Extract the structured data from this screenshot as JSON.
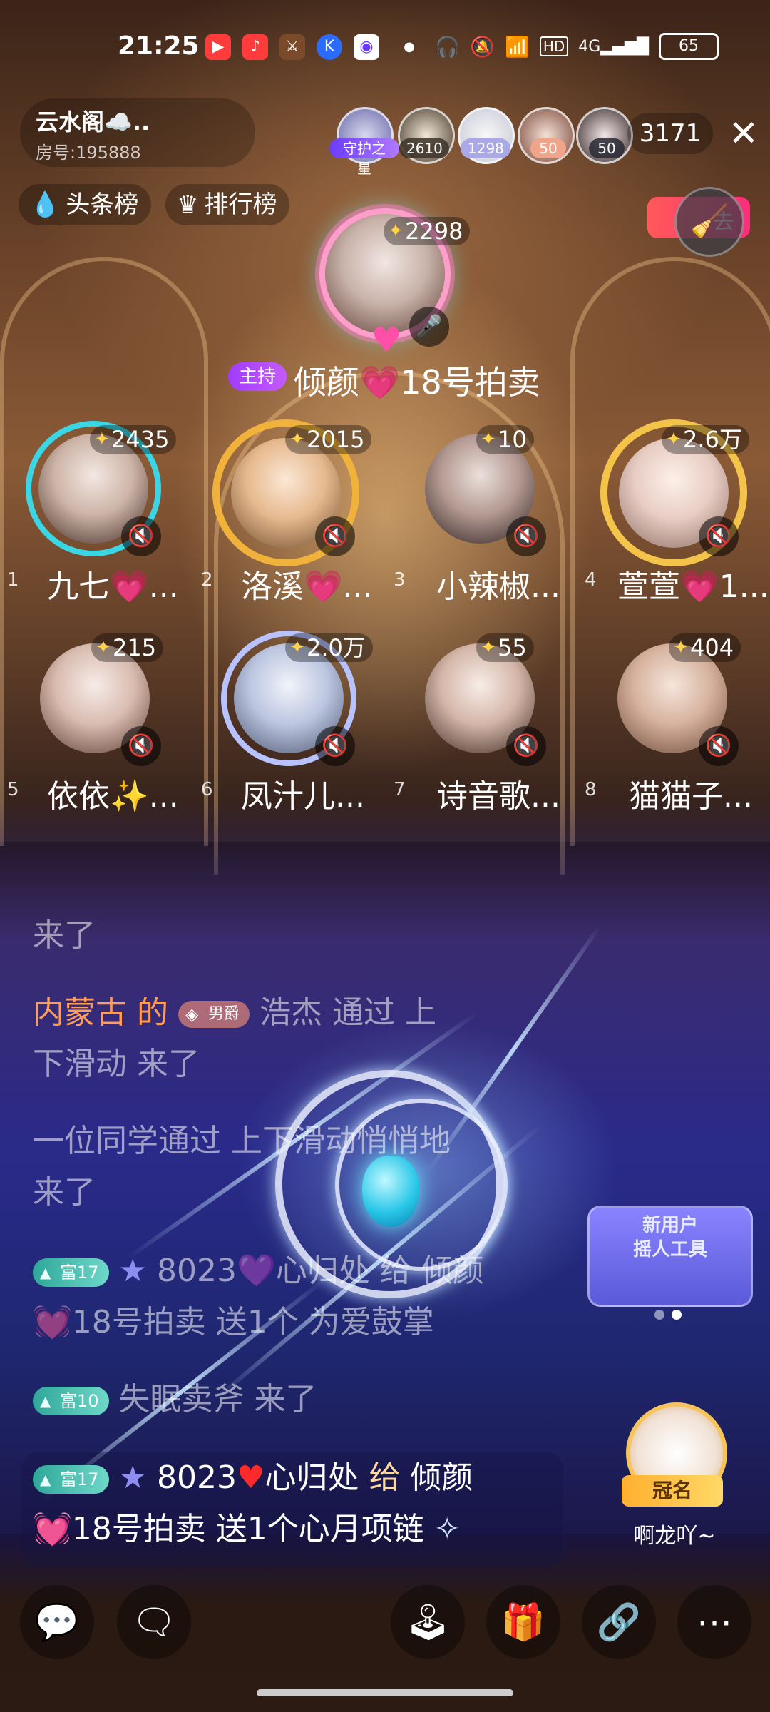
{
  "status_bar": {
    "time": "21:25",
    "network": "4G",
    "hd": "HD",
    "battery": "65"
  },
  "room": {
    "name": "云水阁☁️..",
    "id": "房号:195888",
    "viewer_count": "3171",
    "close_icon": "close-icon"
  },
  "top_audience": {
    "guardian_label": "守护之星",
    "badges": [
      "2610",
      "1298",
      "50",
      "50"
    ]
  },
  "tabs": {
    "headline": "头条榜",
    "ranking": "排行榜"
  },
  "exit_label": "去",
  "host": {
    "tag": "主持",
    "name": "倾颜💗18号拍卖",
    "score": "2298"
  },
  "seats": [
    {
      "num": "1",
      "name": "九七💗...",
      "score": "2435"
    },
    {
      "num": "2",
      "name": "洛溪💗...",
      "score": "2015"
    },
    {
      "num": "3",
      "name": "小辣椒...",
      "score": "10"
    },
    {
      "num": "4",
      "name": "萱萱💗1...",
      "score": "2.6万"
    },
    {
      "num": "5",
      "name": "依依✨...",
      "score": "215"
    },
    {
      "num": "6",
      "name": "凤汁儿...",
      "score": "2.0万"
    },
    {
      "num": "7",
      "name": "诗音歌...",
      "score": "55"
    },
    {
      "num": "8",
      "name": "猫猫子...",
      "score": "404"
    }
  ],
  "chat": {
    "line1": "来了",
    "line2_user": "内蒙古 的",
    "line2_badge": "男爵",
    "line2_rest": "浩杰  通过 上",
    "line3": "下滑动 来了",
    "line4": "一位同学通过 上下滑动悄悄地",
    "line5": "来了",
    "gift1_level": "富17",
    "gift1_text": "8023💜心归处 给 倾颜",
    "gift1_text2": "💓18号拍卖 送1个 为爱鼓掌",
    "join_level": "富10",
    "join_text": "失眠卖斧 来了",
    "gift2_level": "富17",
    "gift2_user": "8023",
    "gift2_user2": "心归处",
    "gift2_action": "给",
    "gift2_target": "倾颜",
    "gift2_line2": "💓18号拍卖 送1个心月项链"
  },
  "widgets": {
    "new_user_line1": "新用户",
    "new_user_line2": "摇人工具",
    "crown_label": "冠名",
    "crown_user": "啊龙吖~"
  },
  "bottom_bar": [
    "chat-bubble-icon",
    "message-icon",
    "game-joystick-icon",
    "gift-icon",
    "link-icon",
    "more-icon"
  ]
}
